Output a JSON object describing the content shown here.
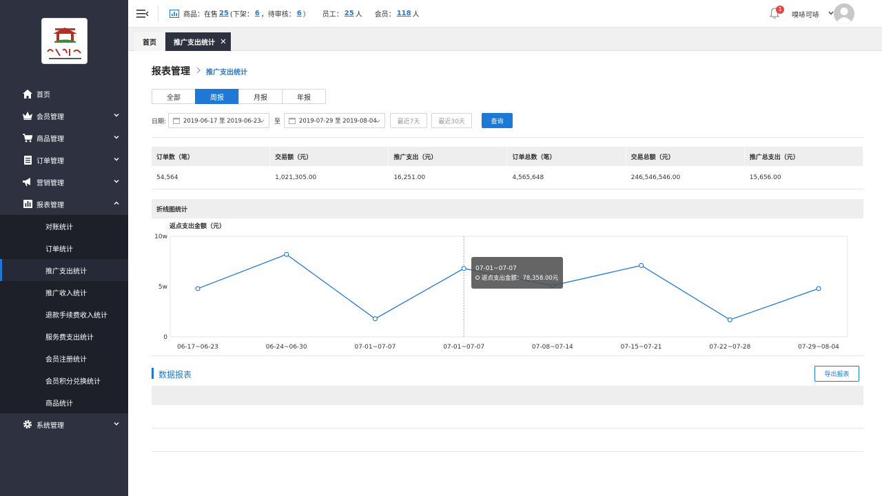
{
  "header": {
    "stats": {
      "goods_label": "商品：在售",
      "on_sale": "25",
      "off_shelf_label": "(下架：",
      "off_shelf": "6",
      "pending_label": "，待审核：",
      "pending": "6",
      "close_paren": "）",
      "staff_label": "员工：",
      "staff": "25",
      "staff_unit": "人",
      "member_label": "会员：",
      "members": "118",
      "member_unit": "人"
    },
    "notification_count": "1",
    "user_name": "嗅哧可哧"
  },
  "sidebar": {
    "items": [
      {
        "label": "首页",
        "icon": "home-icon"
      },
      {
        "label": "会员管理",
        "icon": "crown-icon"
      },
      {
        "label": "商品管理",
        "icon": "cart-icon"
      },
      {
        "label": "订单管理",
        "icon": "order-icon"
      },
      {
        "label": "营销管理",
        "icon": "megaphone-icon"
      },
      {
        "label": "报表管理",
        "icon": "chart-icon"
      }
    ],
    "report_sub": [
      "对账统计",
      "订单统计",
      "推广支出统计",
      "推广收入统计",
      "退款手续费收入统计",
      "服务费支出统计",
      "会员注册统计",
      "会员积分兑换统计",
      "商品统计"
    ],
    "active_sub": "推广支出统计",
    "system": {
      "label": "系统管理",
      "icon": "gear-icon"
    }
  },
  "tabs": {
    "home": "首页",
    "current": "推广支出统计"
  },
  "page": {
    "title": "报表管理",
    "breadcrumb_current": "推广支出统计"
  },
  "period_tabs": [
    "全部",
    "周报",
    "月报",
    "年报"
  ],
  "active_period": "周报",
  "filters": {
    "date_label": "日期:",
    "range1": "2019-06-17 至 2019-06-23",
    "to": "至",
    "range2": "2019-07-29 至 2019-08-04",
    "last7": "最近7天",
    "last30": "最近30天",
    "query": "查询"
  },
  "summary": {
    "headers": [
      "订单数（笔）",
      "交易额（元）",
      "推广支出（元）",
      "订单总数（笔）",
      "交易总额（元）",
      "推广总支出（元）"
    ],
    "values": [
      "54,564",
      "1,021,305.00",
      "16,251.00",
      "4,565,648",
      "246,546,546.00",
      "15,656.00"
    ]
  },
  "chart_panel_title": "折线图统计",
  "chart_data": {
    "type": "line",
    "ylabel": "返点支出金额（元）",
    "y_ticks": [
      "0",
      "5w",
      "10w"
    ],
    "ylim": [
      0,
      100000
    ],
    "categories": [
      "06-17~06-23",
      "06-24~06-30",
      "07-01~07-07",
      "07-01~07-07",
      "07-08~07-14",
      "07-15~07-21",
      "07-22~07-28",
      "07-29~08-04"
    ],
    "series": [
      {
        "values": [
          48000,
          82000,
          18000,
          68000,
          51000,
          71000,
          17000,
          48000
        ]
      }
    ],
    "tooltip": {
      "title": "07-01~07-07",
      "label": "返点支出金额：78,358.00元"
    },
    "line_color": "#1e79d6"
  },
  "report": {
    "title": "数据报表",
    "export": "导出报表"
  }
}
